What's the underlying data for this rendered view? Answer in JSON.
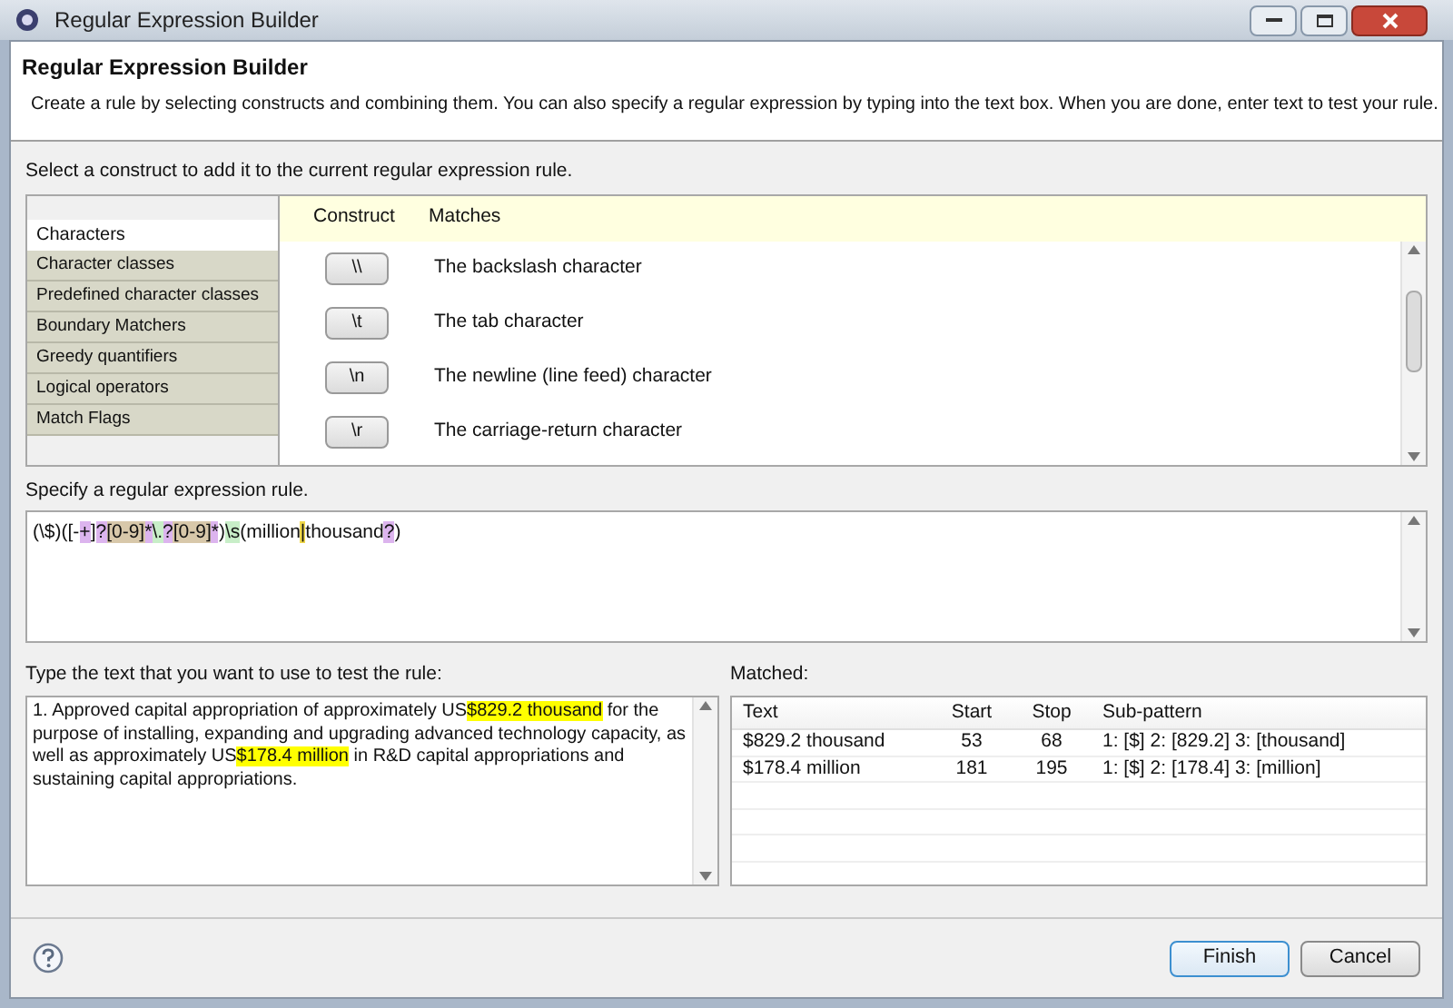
{
  "window": {
    "title": "Regular Expression Builder"
  },
  "header": {
    "title": "Regular Expression Builder",
    "description": "Create a rule by selecting constructs and combining them. You can also specify a regular expression by typing into the text box. When you are done, enter text to test your rule."
  },
  "construct_prompt": "Select a construct to add it to the current regular expression rule.",
  "categories": [
    {
      "label": "Characters",
      "selected": true
    },
    {
      "label": "Character classes",
      "selected": false
    },
    {
      "label": "Predefined character classes",
      "selected": false
    },
    {
      "label": "Boundary Matchers",
      "selected": false
    },
    {
      "label": "Greedy quantifiers",
      "selected": false
    },
    {
      "label": "Logical operators",
      "selected": false
    },
    {
      "label": "Match Flags",
      "selected": false
    }
  ],
  "constructs": {
    "columns": [
      "Construct",
      "Matches"
    ],
    "rows": [
      {
        "construct": "\\\\",
        "matches": "The backslash character"
      },
      {
        "construct": "\\t",
        "matches": "The tab character"
      },
      {
        "construct": "\\n",
        "matches": "The newline (line feed) character"
      },
      {
        "construct": "\\r",
        "matches": "The carriage-return character"
      }
    ]
  },
  "rule_label": "Specify a regular expression rule.",
  "rule": [
    {
      "text": "(\\$)([-"
    },
    {
      "text": "+",
      "color": "#dcb4ee"
    },
    {
      "text": "]"
    },
    {
      "text": "?",
      "color": "#dcb4ee"
    },
    {
      "text": "[0-9]",
      "color": "#d8c8aa"
    },
    {
      "text": "*",
      "color": "#dcb4ee"
    },
    {
      "text": "\\.",
      "color": "#c8eec8"
    },
    {
      "text": "?",
      "color": "#dcb4ee"
    },
    {
      "text": "[0-9]",
      "color": "#d8c8aa"
    },
    {
      "text": "*",
      "color": "#dcb4ee"
    },
    {
      "text": ")"
    },
    {
      "text": "\\s",
      "color": "#c8eec8"
    },
    {
      "text": "(million"
    },
    {
      "text": "|",
      "color": "#f0d84a"
    },
    {
      "text": "thousand"
    },
    {
      "text": "?",
      "color": "#dcb4ee"
    },
    {
      "text": ")"
    }
  ],
  "test_label": "Type the text that you want to use to test the rule:",
  "test_text": [
    {
      "text": "1. Approved capital appropriation of approximately US",
      "matched": false
    },
    {
      "text": "$829.2 thousand",
      "matched": true
    },
    {
      "text": " for the purpose of installing, expanding and upgrading advanced technology capacity, as well as approximately US",
      "matched": false
    },
    {
      "text": "$178.4 million",
      "matched": true
    },
    {
      "text": " in R&D capital appropriations and sustaining capital appropriations.",
      "matched": false
    }
  ],
  "matched_label": "Matched:",
  "matched": {
    "columns": [
      "Text",
      "Start",
      "Stop",
      "Sub-pattern"
    ],
    "rows": [
      [
        "$829.2 thousand",
        "53",
        "68",
        "1: [$] 2: [829.2] 3: [thousand]"
      ],
      [
        "$178.4 million",
        "181",
        "195",
        "1: [$] 2: [178.4] 3: [million]"
      ]
    ]
  },
  "buttons": [
    "Finish",
    "Cancel"
  ]
}
